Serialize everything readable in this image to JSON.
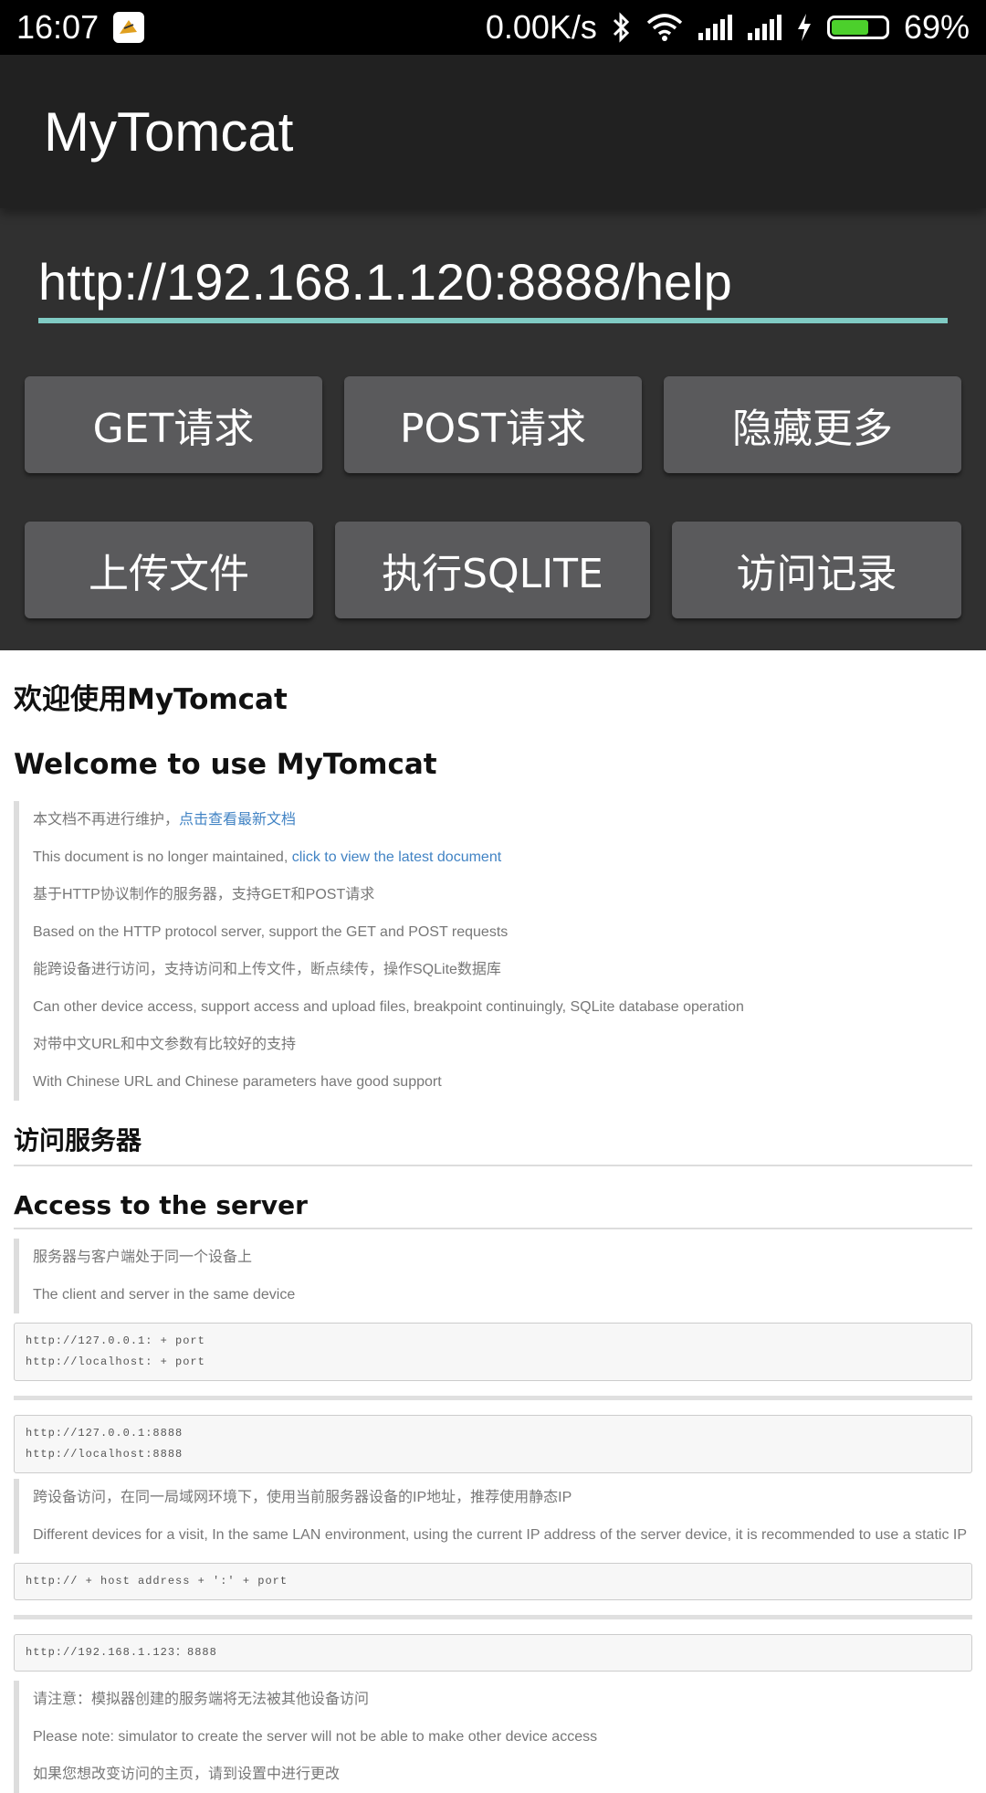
{
  "status_bar": {
    "time": "16:07",
    "network_speed": "0.00K/s",
    "battery_percent": "69%",
    "battery_level": 0.69,
    "icons": [
      "app-notification-icon",
      "bluetooth-icon",
      "wifi-icon",
      "signal-icon",
      "signal-icon",
      "charging-icon",
      "battery-icon"
    ]
  },
  "app_bar": {
    "title": "MyTomcat"
  },
  "controls": {
    "url_value": "http://192.168.1.120:8888/help",
    "buttons_row1": [
      "GET请求",
      "POST请求",
      "隐藏更多"
    ],
    "buttons_row2": [
      "上传文件",
      "执行SQLITE",
      "访问记录"
    ],
    "accent_color": "#80cbc4"
  },
  "doc": {
    "title_cn": "欢迎使用MyTomcat",
    "title_en": "Welcome to use MyTomcat",
    "intro": {
      "line1_text": "本文档不再进行维护，",
      "line1_link": "点击查看最新文档",
      "line2_text": "This document is no longer maintained, ",
      "line2_link": "click to view the latest document",
      "line3": "基于HTTP协议制作的服务器，支持GET和POST请求",
      "line4": "Based on the HTTP protocol server, support the GET and POST requests",
      "line5": "能跨设备进行访问，支持访问和上传文件，断点续传，操作SQLite数据库",
      "line6": "Can other device access, support access and upload files, breakpoint continuingly, SQLite database operation",
      "line7": "对带中文URL和中文参数有比较好的支持",
      "line8": "With Chinese URL and Chinese parameters have good support"
    },
    "access_cn": "访问服务器",
    "access_en": "Access to the server",
    "same_device": {
      "line1": "服务器与客户端处于同一个设备上",
      "line2": "The client and server in the same device"
    },
    "code1": {
      "line1": "http://127.0.0.1: + port",
      "line2": "http://localhost: + port"
    },
    "code2": {
      "line1": "http://127.0.0.1:8888",
      "line2": "http://localhost:8888"
    },
    "cross_device": {
      "line1": "跨设备访问，在同一局域网环境下，使用当前服务器设备的IP地址，推荐使用静态IP",
      "line2": "Different devices for a visit, In the same LAN environment, using the current IP address of the server device, it is recommended to use a static IP"
    },
    "code3": "http:// + host address + ':' + port",
    "code4": "http://192.168.1.123：8888",
    "note": {
      "line1": "请注意：模拟器创建的服务端将无法被其他设备访问",
      "line2": "Please note: simulator to create the server will not be able to make other device access",
      "line3": "如果您想改变访问的主页，请到设置中进行更改"
    },
    "link_color": "#4183c4"
  }
}
